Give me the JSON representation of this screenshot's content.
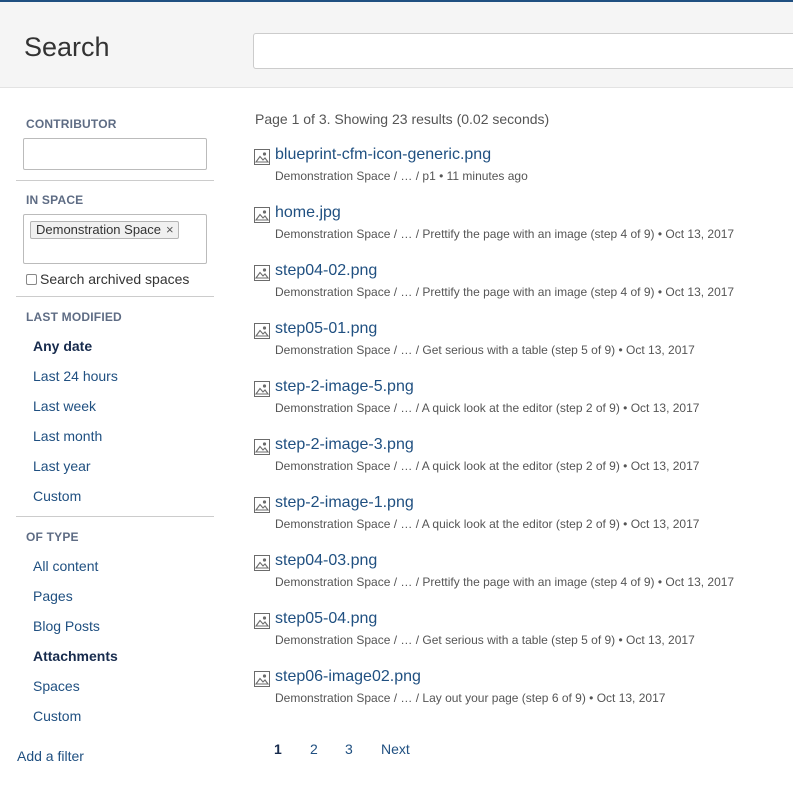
{
  "header": {
    "title": "Search",
    "search_value": "",
    "search_placeholder": ""
  },
  "sidebar": {
    "contributor": {
      "label": "CONTRIBUTOR",
      "value": ""
    },
    "in_space": {
      "label": "IN SPACE",
      "chip": "Demonstration Space",
      "chip_remove": "×",
      "archived_label": "Search archived spaces",
      "archived_checked": false
    },
    "last_modified": {
      "label": "LAST MODIFIED",
      "options": [
        "Any date",
        "Last 24 hours",
        "Last week",
        "Last month",
        "Last year",
        "Custom"
      ],
      "selected": "Any date"
    },
    "of_type": {
      "label": "OF TYPE",
      "options": [
        "All content",
        "Pages",
        "Blog Posts",
        "Attachments",
        "Spaces",
        "Custom"
      ],
      "selected": "Attachments"
    },
    "add_filter": "Add a filter"
  },
  "results": {
    "summary": "Page 1 of 3. Showing 23 results (0.02 seconds)",
    "icon": "image-file-icon",
    "items": [
      {
        "title": "blueprint-cfm-icon-generic.png",
        "meta": "Demonstration Space / … / p1 • 11 minutes ago"
      },
      {
        "title": "home.jpg",
        "meta": "Demonstration Space / … / Prettify the page with an image (step 4 of 9) • Oct 13, 2017"
      },
      {
        "title": "step04-02.png",
        "meta": "Demonstration Space / … / Prettify the page with an image (step 4 of 9) • Oct 13, 2017"
      },
      {
        "title": "step05-01.png",
        "meta": "Demonstration Space / … / Get serious with a table (step 5 of 9) • Oct 13, 2017"
      },
      {
        "title": "step-2-image-5.png",
        "meta": "Demonstration Space / … / A quick look at the editor (step 2 of 9) • Oct 13, 2017"
      },
      {
        "title": "step-2-image-3.png",
        "meta": "Demonstration Space / … / A quick look at the editor (step 2 of 9) • Oct 13, 2017"
      },
      {
        "title": "step-2-image-1.png",
        "meta": "Demonstration Space / … / A quick look at the editor (step 2 of 9) • Oct 13, 2017"
      },
      {
        "title": "step04-03.png",
        "meta": "Demonstration Space / … / Prettify the page with an image (step 4 of 9) • Oct 13, 2017"
      },
      {
        "title": "step05-04.png",
        "meta": "Demonstration Space / … / Get serious with a table (step 5 of 9) • Oct 13, 2017"
      },
      {
        "title": "step06-image02.png",
        "meta": "Demonstration Space / … / Lay out your page (step 6 of 9) • Oct 13, 2017"
      }
    ]
  },
  "pagination": {
    "pages": [
      "1",
      "2",
      "3"
    ],
    "current": "1",
    "next": "Next"
  },
  "colors": {
    "link": "#205081",
    "text": "#172b4d",
    "muted": "#555555",
    "header_bg": "#f5f5f5",
    "top_line": "#205081"
  }
}
